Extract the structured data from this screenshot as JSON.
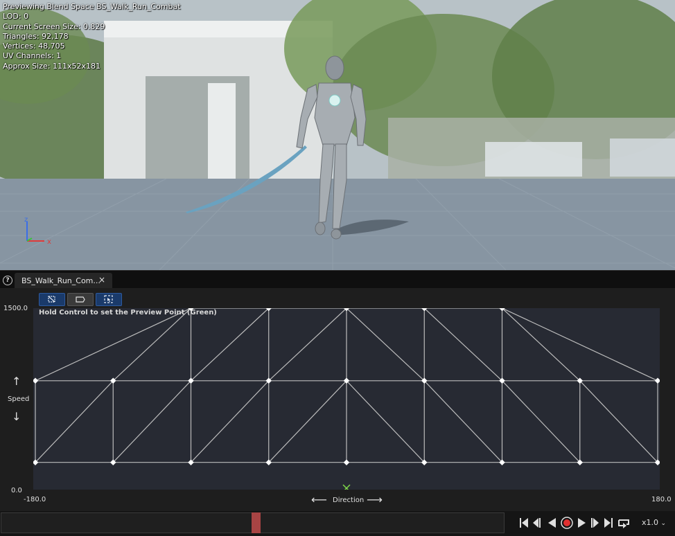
{
  "viewport": {
    "stats": [
      "Previewing Blend Space BS_Walk_Run_Combat",
      "LOD: 0",
      "Current Screen Size: 0.829",
      "Triangles: 92,178",
      "Vertices: 48,705",
      "UV Channels: 1",
      "Approx Size: 111x52x181"
    ],
    "gizmo": {
      "z": "z",
      "x": "x"
    }
  },
  "tab": {
    "label": "BS_Walk_Run_Com...",
    "close": "×",
    "help": "?"
  },
  "editor": {
    "hint": "Hold Control to set the Preview Point (Green)",
    "y_axis": {
      "label": "Speed",
      "min": "0.0",
      "max": "1500.0"
    },
    "x_axis": {
      "label": "Direction",
      "min": "-180.0",
      "max": "180.0"
    },
    "grid": {
      "x_min": -180,
      "x_max": 180,
      "y_min": 0,
      "y_max": 1500,
      "colors": {
        "plot_bg": "#272a33",
        "line": "#bdbdbd",
        "preview": "#7fd84a"
      }
    },
    "samples": [
      [
        -180,
        225
      ],
      [
        -135,
        225
      ],
      [
        -90,
        225
      ],
      [
        -45,
        225
      ],
      [
        0,
        225
      ],
      [
        45,
        225
      ],
      [
        90,
        225
      ],
      [
        135,
        225
      ],
      [
        180,
        225
      ],
      [
        -180,
        900
      ],
      [
        -135,
        900
      ],
      [
        -90,
        900
      ],
      [
        -45,
        900
      ],
      [
        0,
        900
      ],
      [
        45,
        900
      ],
      [
        90,
        900
      ],
      [
        135,
        900
      ],
      [
        180,
        900
      ],
      [
        -90,
        1500
      ],
      [
        -45,
        1500
      ],
      [
        0,
        1500
      ],
      [
        45,
        1500
      ],
      [
        90,
        1500
      ]
    ],
    "preview_point": [
      0,
      0
    ]
  },
  "timeline": {
    "speed": "x1.0"
  }
}
